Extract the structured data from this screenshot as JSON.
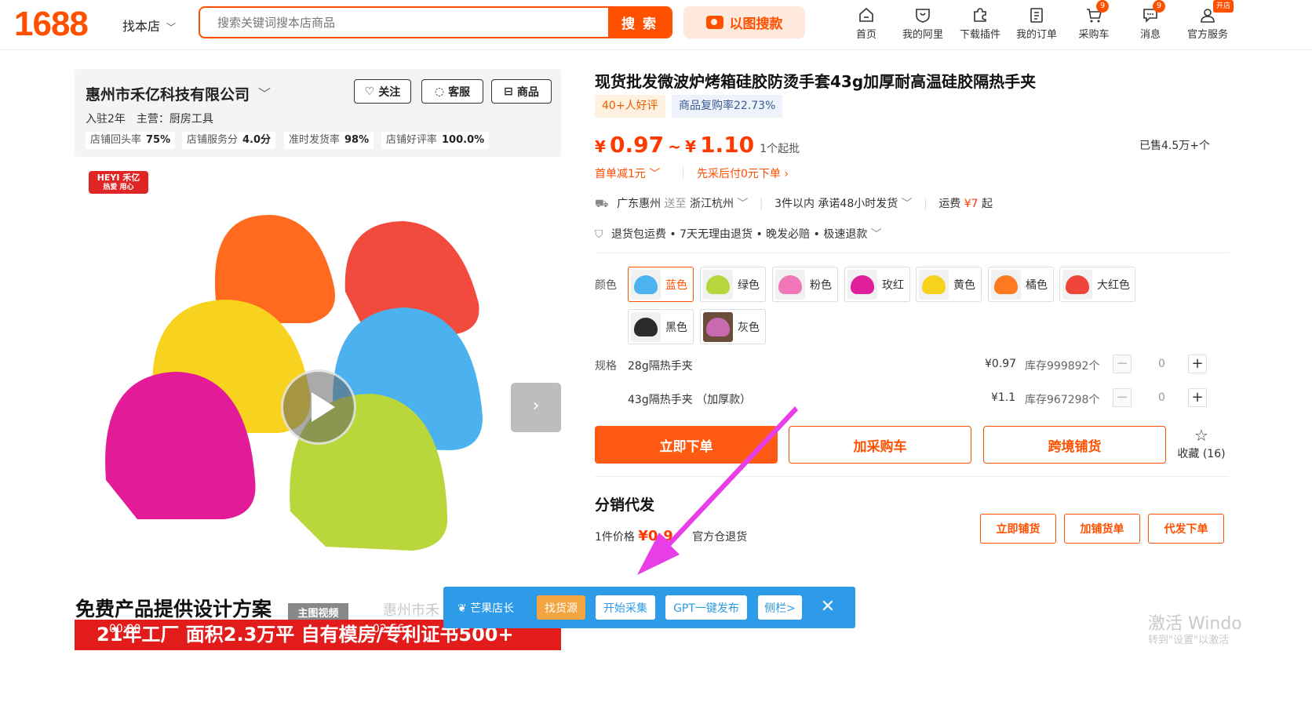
{
  "header": {
    "logo": "1688",
    "scope_label": "找本店",
    "search_placeholder": "搜索关键词搜本店商品",
    "search_button": "搜 索",
    "image_search": "以图搜款",
    "nav": [
      {
        "label": "首页",
        "icon": "home-icon"
      },
      {
        "label": "我的阿里",
        "icon": "heart-shield-icon"
      },
      {
        "label": "下载插件",
        "icon": "puzzle-icon"
      },
      {
        "label": "我的订单",
        "icon": "order-list-icon"
      },
      {
        "label": "采购车",
        "icon": "cart-icon",
        "badge": "9"
      },
      {
        "label": "消息",
        "icon": "message-icon",
        "badge": "9"
      },
      {
        "label": "官方服务",
        "icon": "user-service-icon",
        "badge": "开店"
      }
    ]
  },
  "shop": {
    "name": "惠州市禾亿科技有限公司",
    "follow": "关注",
    "service": "客服",
    "goods": "商品",
    "years": "入驻2年",
    "main_business": "主营：厨房工具",
    "stats": [
      {
        "label": "店铺回头率",
        "value": "75%"
      },
      {
        "label": "店铺服务分",
        "value": "4.0分"
      },
      {
        "label": "准时发货率",
        "value": "98%"
      },
      {
        "label": "店铺好评率",
        "value": "100.0%"
      }
    ]
  },
  "gallery": {
    "brand_logo": "HEYI 禾亿",
    "brand_slogan": "热爱 用心",
    "overlay_text": "免费产品提供设计方案",
    "main_video_tag": "主图视频",
    "shop_watermark": "惠州市禾",
    "banner_text": "21年工厂 面积2.3万平 自有模房/专利证书500+",
    "video_current": "00:00",
    "video_total": "02:56"
  },
  "product": {
    "title": "现货批发微波炉烤箱硅胶防烫手套43g加厚耐高温硅胶隔热手夹",
    "tag_reviews": "40+人好评",
    "tag_repurchase": "商品复购率22.73%",
    "price_symbol": "¥",
    "price_low": "0.97",
    "price_tilde": "~",
    "price_high": "1.10",
    "min_order": "1个起批",
    "sold": "已售4.5万+个",
    "promo_first": "首单减1元",
    "promo_paylater": "先采后付0元下单",
    "ship_from": "广东惠州",
    "ship_to_word": "送至",
    "ship_to": "浙江杭州",
    "ship_promise": "3件以内  承诺48小时发货",
    "freight_label": "运费",
    "freight_value": "¥7",
    "freight_suffix": "起",
    "guarantee": "退货包运费 • 7天无理由退货 • 晚发必赔 • 极速退款",
    "color_label": "颜色",
    "spec_label": "规格",
    "colors": [
      {
        "name": "蓝色",
        "hex": "#4db3f0"
      },
      {
        "name": "绿色",
        "hex": "#b7d63c"
      },
      {
        "name": "粉色",
        "hex": "#f077b8"
      },
      {
        "name": "玫红",
        "hex": "#e0209a"
      },
      {
        "name": "黄色",
        "hex": "#f5d21c"
      },
      {
        "name": "橘色",
        "hex": "#ff7a1e"
      },
      {
        "name": "大红色",
        "hex": "#f0453a"
      },
      {
        "name": "黑色",
        "hex": "#2b2b2b"
      },
      {
        "name": "灰色",
        "hex": "#888888"
      }
    ],
    "specs": [
      {
        "name": "28g隔热手夹",
        "price": "¥0.97",
        "stock": "库存999892个",
        "qty": "0"
      },
      {
        "name": "43g隔热手夹 （加厚款）",
        "price": "¥1.1",
        "stock": "库存967298个",
        "qty": "0"
      }
    ],
    "buy_now": "立即下单",
    "add_cart": "加采购车",
    "cross_border": "跨境铺货",
    "collect": "收藏 (16)"
  },
  "distribution": {
    "title": "分销代发",
    "price_label": "1件价格",
    "price_value": "¥0.9",
    "return_text": "官方仓退货",
    "buttons": [
      "立即铺货",
      "加铺货单",
      "代发下单"
    ]
  },
  "mango": {
    "label": "芒果店长",
    "find": "找货源",
    "collect": "开始采集",
    "gpt": "GPT一键发布",
    "sidebar": "侧栏>",
    "close": "✕"
  },
  "windows": {
    "line1": "激活 Windo",
    "line2": "转到\"设置\"以激活"
  },
  "colors": {
    "accent": "#ff5000",
    "mango": "#2d9be8",
    "arrow": "#e83ee8"
  }
}
